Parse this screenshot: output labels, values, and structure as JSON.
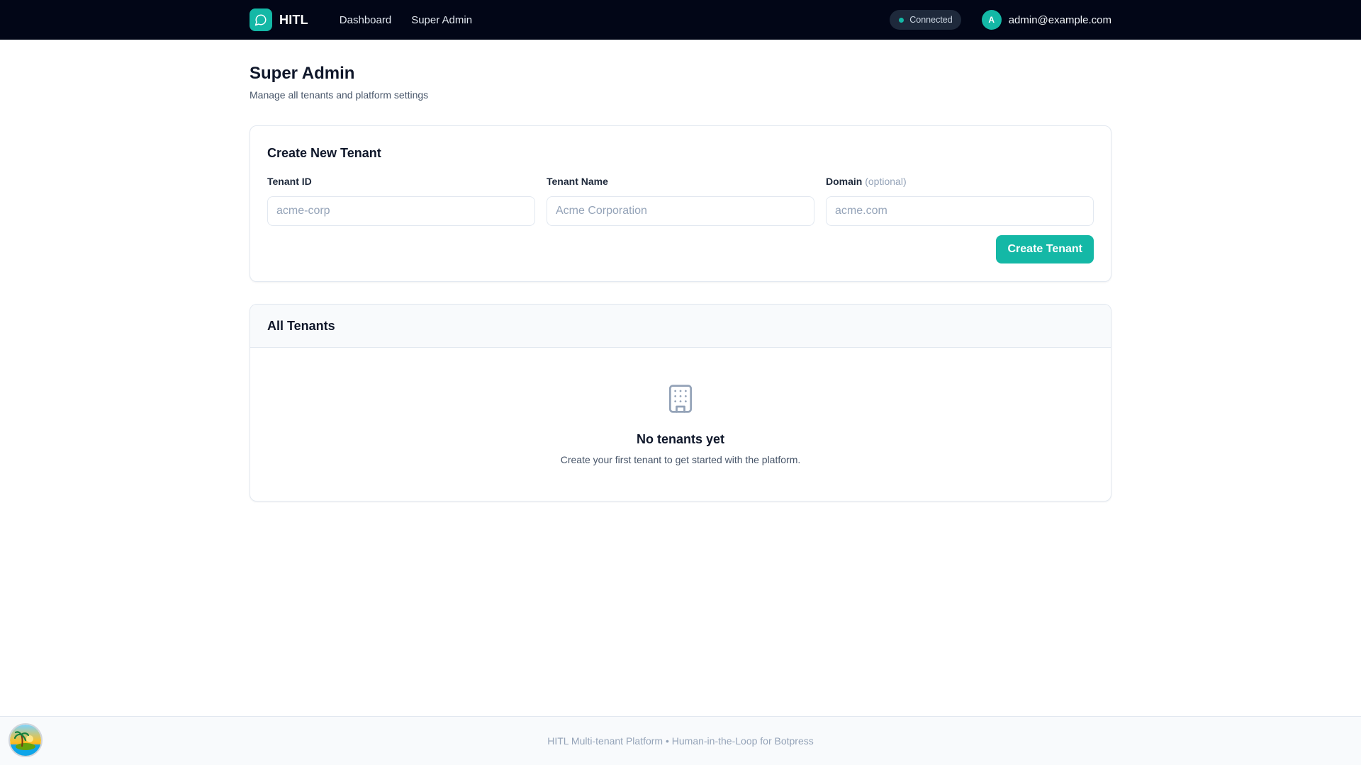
{
  "header": {
    "brand_name": "HITL",
    "nav": [
      {
        "label": "Dashboard"
      },
      {
        "label": "Super Admin"
      }
    ],
    "status": "Connected",
    "user": {
      "initial": "A",
      "email": "admin@example.com"
    }
  },
  "page": {
    "title": "Super Admin",
    "subtitle": "Manage all tenants and platform settings"
  },
  "create_tenant": {
    "title": "Create New Tenant",
    "fields": [
      {
        "label": "Tenant ID",
        "placeholder": "acme-corp",
        "value": ""
      },
      {
        "label": "Tenant Name",
        "placeholder": "Acme Corporation",
        "value": ""
      },
      {
        "label": "Domain",
        "optional_note": "(optional)",
        "placeholder": "acme.com",
        "value": ""
      }
    ],
    "submit_label": "Create Tenant"
  },
  "all_tenants": {
    "title": "All Tenants",
    "empty_title": "No tenants yet",
    "empty_description": "Create your first tenant to get started with the platform."
  },
  "footer": {
    "text": "HITL Multi-tenant Platform • Human-in-the-Loop for Botpress"
  },
  "icons": {
    "brand": "chat-bubble-icon",
    "empty_state": "building-icon",
    "status": "status-dot-icon"
  },
  "colors": {
    "accent": "#14b8a6",
    "topbar": "#020617",
    "status_pill": "#1e293b"
  }
}
